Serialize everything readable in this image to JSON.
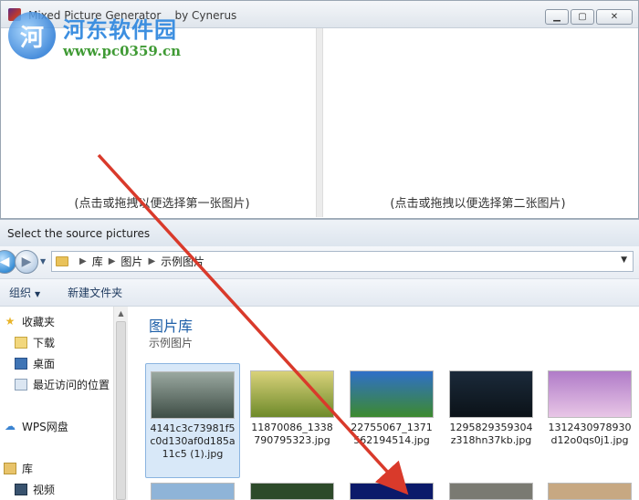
{
  "app": {
    "title": "Mixed Picture Generator    by Cynerus",
    "left_hint": "(点击或拖拽以便选择第一张图片)",
    "right_hint": "(点击或拖拽以便选择第二张图片)"
  },
  "watermark": {
    "logo_char": "河",
    "text": "河东软件园",
    "url": "www.pc0359.cn"
  },
  "dialog": {
    "title": "Select the source pictures",
    "breadcrumb": [
      "库",
      "图片",
      "示例图片"
    ],
    "toolbar": {
      "organize": "组织",
      "new_folder": "新建文件夹"
    },
    "nav": {
      "favorites": "收藏夹",
      "downloads": "下载",
      "desktop": "桌面",
      "recent": "最近访问的位置",
      "wps": "WPS网盘",
      "libraries": "库",
      "videos": "视频"
    },
    "library_title": "图片库",
    "library_subtitle": "示例图片",
    "files": [
      {
        "name": "4141c3c73981f5c0d130af0d185a11c5 (1).jpg",
        "selected": true,
        "colors": [
          "#9aa8a0",
          "#3e4d45"
        ]
      },
      {
        "name": "11870086_1338790795323.jpg",
        "selected": false,
        "colors": [
          "#d9d27a",
          "#6e8a2a"
        ]
      },
      {
        "name": "22755067_1371562194514.jpg",
        "selected": false,
        "colors": [
          "#2f6fc9",
          "#3d8a2e"
        ]
      },
      {
        "name": "1295829359304z318hn37kb.jpg",
        "selected": false,
        "colors": [
          "#1b2a3a",
          "#0b1218"
        ]
      },
      {
        "name": "1312430978930d12o0qs0j1.jpg",
        "selected": false,
        "colors": [
          "#b07bc8",
          "#e8c6e6"
        ]
      }
    ]
  },
  "colors": {
    "annotation_arrow": "#d93a2b",
    "library_title": "#1e5fa8"
  }
}
